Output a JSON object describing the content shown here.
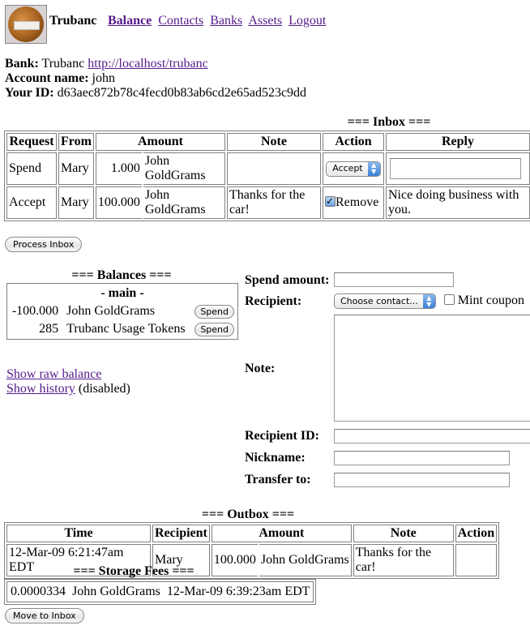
{
  "header": {
    "logo_icon": "gold-coin-logo",
    "brand": "Trubanc",
    "nav": [
      {
        "label": "Balance",
        "active": true
      },
      {
        "label": "Contacts",
        "active": false
      },
      {
        "label": "Banks",
        "active": false
      },
      {
        "label": "Assets",
        "active": false
      },
      {
        "label": "Logout",
        "active": false
      }
    ]
  },
  "info": {
    "bank_label": "Bank:",
    "bank_name": "Trubanc",
    "bank_url": "http://localhost/trubanc",
    "account_label": "Account name:",
    "account_name": "john",
    "id_label": "Your ID:",
    "id_value": "d63aec872b78c4fecd0b83ab6cd2e65ad523c9dd"
  },
  "inbox": {
    "title": "=== Inbox ===",
    "columns": [
      "Request",
      "From",
      "Amount",
      "Note",
      "Action",
      "Reply"
    ],
    "rows": [
      {
        "request": "Spend",
        "from": "Mary",
        "amount": "1.000",
        "asset": "John GoldGrams",
        "note": "",
        "action_type": "select",
        "action_value": "Accept",
        "reply": ""
      },
      {
        "request": "Accept",
        "from": "Mary",
        "amount": "100.000",
        "asset": "John GoldGrams",
        "note": "Thanks for the car!",
        "action_type": "checkbox",
        "action_value": "Remove",
        "action_checked": true,
        "reply": "Nice doing business with you."
      }
    ],
    "process_button": "Process Inbox"
  },
  "balances": {
    "title": "=== Balances ===",
    "group": "- main -",
    "rows": [
      {
        "amount": "-100.000",
        "asset": "John GoldGrams",
        "button": "Spend"
      },
      {
        "amount": "285",
        "asset": "Trubanc Usage Tokens",
        "button": "Spend"
      }
    ],
    "show_raw": "Show raw balance",
    "show_history": "Show history",
    "history_note": "(disabled)"
  },
  "spend_form": {
    "spend_amount_label": "Spend amount:",
    "spend_amount_value": "",
    "recipient_label": "Recipient:",
    "recipient_select": "Choose contact...",
    "mint_coupon_label": "Mint coupon",
    "mint_coupon_checked": false,
    "note_label": "Note:",
    "note_value": "",
    "recipient_id_label": "Recipient ID:",
    "recipient_id_value": "",
    "nickname_label": "Nickname:",
    "nickname_value": "",
    "transfer_label": "Transfer to:",
    "transfer_value": ""
  },
  "outbox": {
    "title": "=== Outbox ===",
    "columns": [
      "Time",
      "Recipient",
      "Amount",
      "Note",
      "Action"
    ],
    "rows": [
      {
        "time": "12-Mar-09 6:21:47am EDT",
        "recipient": "Mary",
        "amount": "100.000",
        "asset": "John GoldGrams",
        "note": "Thanks for the car!",
        "action": ""
      }
    ]
  },
  "storage_fees": {
    "title": "=== Storage Fees ===",
    "amount": "0.0000334",
    "asset": "John GoldGrams",
    "time": "12-Mar-09 6:39:23am EDT",
    "move_button": "Move to Inbox"
  }
}
